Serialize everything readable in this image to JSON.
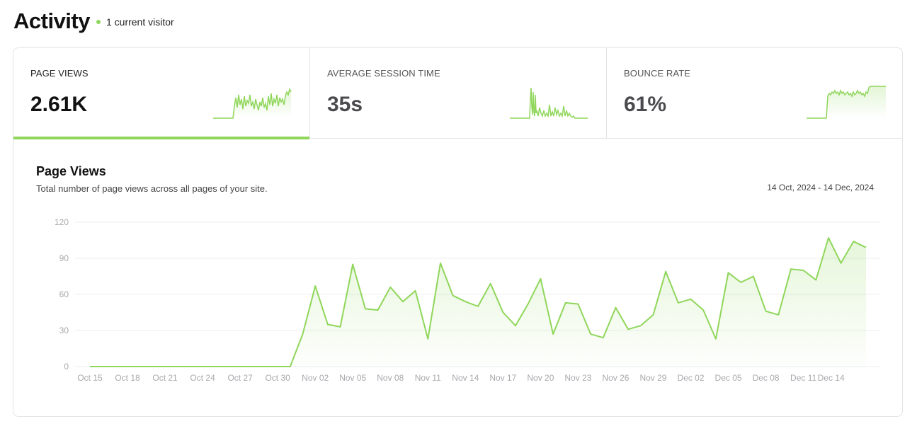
{
  "header": {
    "title": "Activity",
    "visitor_text": "1 current visitor"
  },
  "colors": {
    "accent": "#8fd65a",
    "grid": "#ececef",
    "axis_text": "#a8a8ad"
  },
  "tabs": [
    {
      "label": "PAGE VIEWS",
      "value": "2.61K",
      "active": true
    },
    {
      "label": "AVERAGE SESSION TIME",
      "value": "35s",
      "active": false
    },
    {
      "label": "BOUNCE RATE",
      "value": "61%",
      "active": false
    }
  ],
  "chart": {
    "title": "Page Views",
    "subtitle": "Total number of page views across all pages of your site.",
    "date_range": "14 Oct, 2024 - 14 Dec, 2024"
  },
  "chart_data": {
    "type": "area",
    "title": "Page Views",
    "ylim": [
      0,
      120
    ],
    "yticks": [
      0,
      30,
      60,
      90,
      120
    ],
    "x_tick_labels": [
      "Oct 15",
      "Oct 18",
      "Oct 21",
      "Oct 24",
      "Oct 27",
      "Oct 30",
      "Nov 02",
      "Nov 05",
      "Nov 08",
      "Nov 11",
      "Nov 14",
      "Nov 17",
      "Nov 20",
      "Nov 23",
      "Nov 26",
      "Nov 29",
      "Dec 02",
      "Dec 05",
      "Dec 08",
      "Dec 11",
      "Dec 14"
    ],
    "x_start": "Oct 15",
    "x_end": "Dec 15",
    "grid": true,
    "series": [
      {
        "values": [
          0,
          0,
          0,
          0,
          0,
          0,
          0,
          0,
          0,
          0,
          0,
          0,
          0,
          0,
          0,
          0,
          0,
          27,
          67,
          35,
          33,
          85,
          48,
          47,
          66,
          54,
          63,
          23,
          86,
          59,
          54,
          50,
          69,
          45,
          34,
          52,
          73,
          27,
          53,
          52,
          27,
          24,
          49,
          31,
          34,
          43,
          79,
          53,
          56,
          47,
          23,
          78,
          70,
          75,
          46,
          43,
          81,
          80,
          72,
          107,
          86,
          104,
          99
        ]
      }
    ]
  }
}
